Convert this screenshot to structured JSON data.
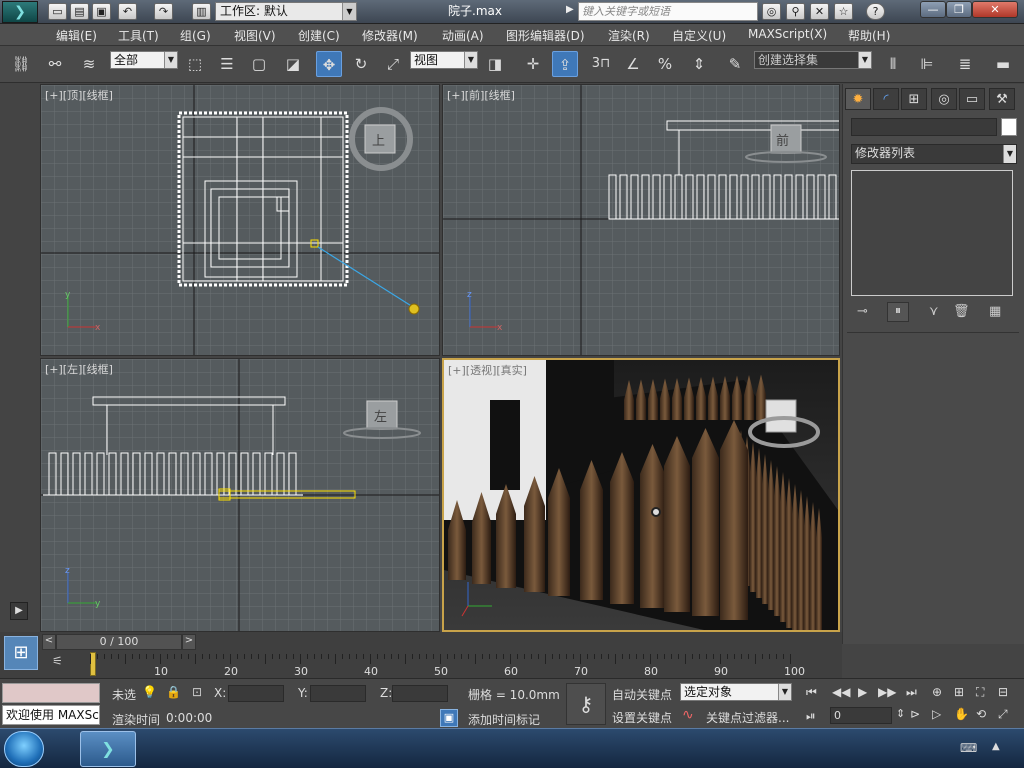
{
  "titlebar": {
    "workspace_label": "工作区: 默认",
    "doc_title": "院子.max",
    "search_placeholder": "键入关键字或短语"
  },
  "menu": {
    "items": [
      "编辑(E)",
      "工具(T)",
      "组(G)",
      "视图(V)",
      "创建(C)",
      "修改器(M)",
      "动画(A)",
      "图形编辑器(D)",
      "渲染(R)",
      "自定义(U)",
      "MAXScript(X)",
      "帮助(H)"
    ]
  },
  "toolbar": {
    "selection_filter": "全部",
    "ref_coord": "视图",
    "named_selection": "创建选择集",
    "snap_value": "3"
  },
  "viewports": {
    "top_label": "[+][顶][线框]",
    "front_label": "[+][前][线框]",
    "left_label": "[+][左][线框]",
    "persp_label": "[+][透视][真实]",
    "viewcube_top": "上",
    "viewcube_front": "前",
    "viewcube_left": "左"
  },
  "command_panel": {
    "name_field": "",
    "modifier_list": "修改器列表"
  },
  "timeline": {
    "frame_display": "0 / 100",
    "tick_labels": [
      "10",
      "20",
      "30",
      "40",
      "50",
      "60",
      "70",
      "80",
      "90",
      "100"
    ]
  },
  "status": {
    "maxscript_listener": "欢迎使用 MAXScri",
    "selection_status": "未选",
    "x_label": "X:",
    "y_label": "Y:",
    "z_label": "Z:",
    "grid": "栅格 = 10.0mm",
    "render_time_label": "渲染时间",
    "render_time_value": "0:00:00",
    "add_time_tag": "添加时间标记",
    "auto_key": "自动关键点",
    "set_key": "设置关键点",
    "key_mode": "选定对象",
    "key_filters": "关键点过滤器...",
    "current_frame": "0"
  },
  "colors": {
    "viewport_bg": "#555b5e",
    "active_border": "#c8a34a",
    "highlight_blue": "#3f78b8"
  }
}
